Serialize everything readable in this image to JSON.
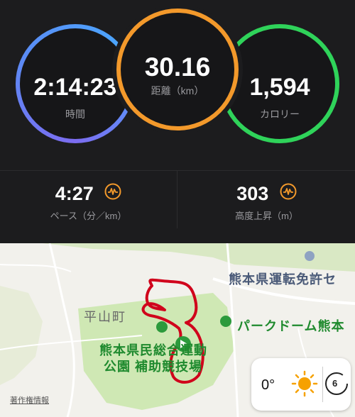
{
  "summary": {
    "time": {
      "value": "2:14:23",
      "label": "時間",
      "color": "#6a7cf2"
    },
    "distance": {
      "value": "30.16",
      "label": "距離（km）",
      "color": "#f3992b"
    },
    "calories": {
      "value": "1,594",
      "label": "カロリー",
      "color": "#2fd35a"
    }
  },
  "metrics": {
    "pace": {
      "value": "4:27",
      "label": "ペース（分／km）",
      "icon": "waveform-icon"
    },
    "elevation": {
      "value": "303",
      "label": "高度上昇（m）",
      "icon": "waveform-icon"
    }
  },
  "map": {
    "labels": {
      "license_center": "熊本県運転免許セ",
      "hirayama": "平山町",
      "park_dome": "パークドーム熊本",
      "park_line1": "熊本県民総合運動",
      "park_line2": "公園 補助競技場",
      "legal": "著作権情報"
    },
    "route_color": "#d0021b",
    "park_color": "#cfe8b4"
  },
  "weather": {
    "temperature": "0°",
    "icon": "sun-icon",
    "aqi_value": "6"
  }
}
